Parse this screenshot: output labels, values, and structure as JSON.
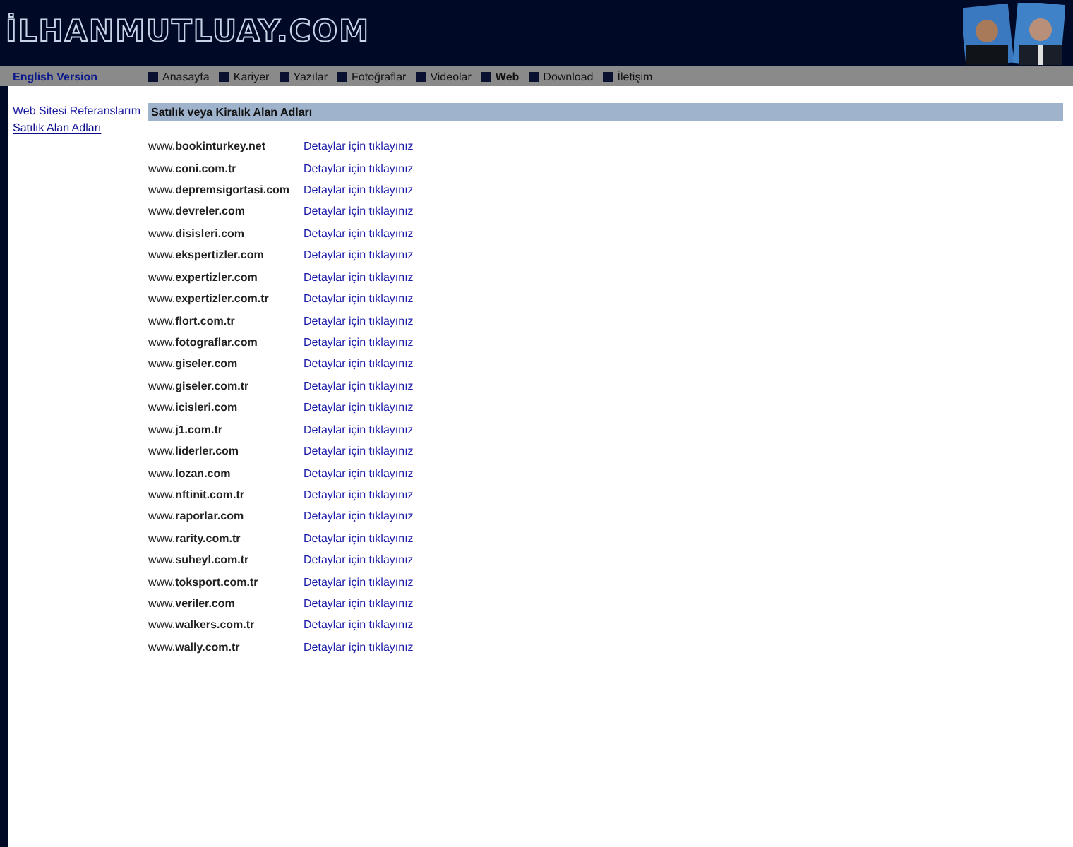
{
  "logo": "İLHANMUTLUAY.COM",
  "nav": {
    "language": "English Version",
    "items": [
      {
        "label": "Anasayfa",
        "selected": false
      },
      {
        "label": "Kariyer",
        "selected": false
      },
      {
        "label": "Yazılar",
        "selected": false
      },
      {
        "label": "Fotoğraflar",
        "selected": false
      },
      {
        "label": "Videolar",
        "selected": false
      },
      {
        "label": "Web",
        "selected": true
      },
      {
        "label": "Download",
        "selected": false
      },
      {
        "label": "İletişim",
        "selected": false
      }
    ]
  },
  "sidebar": {
    "items": [
      {
        "label": "Web Sitesi Referanslarım",
        "selected": false
      },
      {
        "label": "Satılık Alan Adları",
        "selected": true
      }
    ]
  },
  "content": {
    "title": "Satılık veya Kiralık Alan Adları",
    "rows": [
      {
        "domain": "www.**bookinturkey.net**",
        "link": "Detaylar için tıklayınız"
      },
      {
        "domain": "www.**coni.com.tr**",
        "link": "Detaylar için tıklayınız"
      },
      {
        "domain": "www.**depremsigortasi.com**",
        "link": "Detaylar için tıklayınız"
      },
      {
        "domain": "www.**devreler.com**",
        "link": "Detaylar için tıklayınız"
      },
      {
        "domain": "www.**disisleri.com**",
        "link": "Detaylar için tıklayınız"
      },
      {
        "domain": "www.**ekspertizler.com**",
        "link": "Detaylar için tıklayınız"
      },
      {
        "domain": "www.**expertizler.com**",
        "link": "Detaylar için tıklayınız"
      },
      {
        "domain": "www.**expertizler.com.tr**",
        "link": "Detaylar için tıklayınız"
      },
      {
        "domain": "www.**flort.com.tr**",
        "link": "Detaylar için tıklayınız"
      },
      {
        "domain": "www.**fotograflar.com**",
        "link": "Detaylar için tıklayınız"
      },
      {
        "domain": "www.**giseler.com**",
        "link": "Detaylar için tıklayınız"
      },
      {
        "domain": "www.**giseler.com.tr**",
        "link": "Detaylar için tıklayınız"
      },
      {
        "domain": "www.**icisleri.com**",
        "link": "Detaylar için tıklayınız"
      },
      {
        "domain": "www.**j1.com.tr**",
        "link": "Detaylar için tıklayınız"
      },
      {
        "domain": "www.**liderler.com**",
        "link": "Detaylar için tıklayınız"
      },
      {
        "domain": "www.**lozan.com**",
        "link": "Detaylar için tıklayınız"
      },
      {
        "domain": "www.**nftinit.com.tr**",
        "link": "Detaylar için tıklayınız"
      },
      {
        "domain": "www.**raporlar.com**",
        "link": "Detaylar için tıklayınız"
      },
      {
        "domain": "www.**rarity.com.tr**",
        "link": "Detaylar için tıklayınız"
      },
      {
        "domain": "www.**suheyl.com.tr**",
        "link": "Detaylar için tıklayınız"
      },
      {
        "domain": "www.**toksport.com.tr**",
        "link": "Detaylar için tıklayınız"
      },
      {
        "domain": "www.**veriler.com**",
        "link": "Detaylar için tıklayınız"
      },
      {
        "domain": "www.**walkers.com.tr**",
        "link": "Detaylar için tıklayınız"
      },
      {
        "domain": "www.**wally.com.tr**",
        "link": "Detaylar için tıklayınız"
      }
    ]
  }
}
